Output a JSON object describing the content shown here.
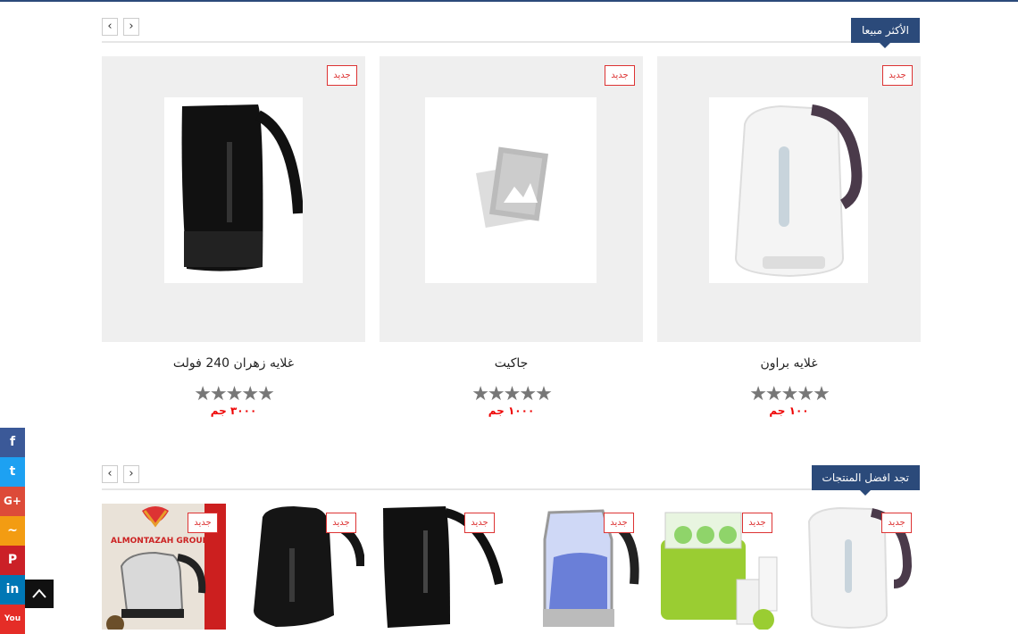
{
  "sections": {
    "best_sellers": {
      "title": "الأكثر مبيعا",
      "prev": "‹",
      "next": "›"
    },
    "best_products": {
      "title": "تجد افضل المنتجات",
      "prev": "‹",
      "next": "›"
    }
  },
  "badge_label": "جديد",
  "products": [
    {
      "name": "غلايه براون",
      "rating": "★★★★★",
      "price": "١٠٠ جم"
    },
    {
      "name": "جاكيت",
      "rating": "★★★★★",
      "price": "١٠٠٠ جم"
    },
    {
      "name": "غلايه زهران 240 فولت",
      "rating": "★★★★★",
      "price": "٣٠٠٠ جم"
    }
  ],
  "thumb_logo": {
    "line1": "ALMONTAZAH GROUP"
  },
  "social": {
    "facebook": "f",
    "twitter": "t",
    "googleplus": "G+",
    "rss": "~",
    "pinterest": "P",
    "linkedin": "in",
    "youtube": "You"
  },
  "colors": {
    "accent": "#2b4a7a",
    "badge": "#dd3333",
    "price": "#ee0000"
  }
}
